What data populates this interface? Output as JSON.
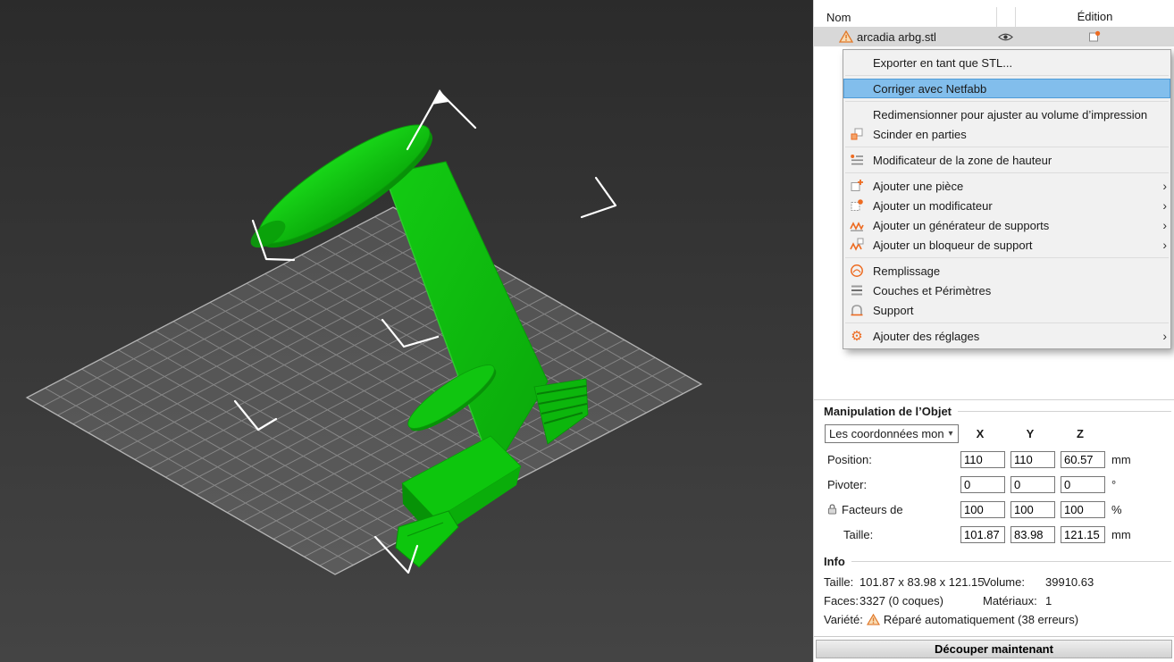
{
  "colors": {
    "accent_orange": "#ED6B21",
    "model_green": "#0CC40C",
    "menu_highlight": "#82BEEC",
    "selected_row": "#D8D8D8"
  },
  "object_list": {
    "columns": {
      "nom": "Nom",
      "edition": "Édition"
    },
    "row": {
      "filename": "arcadia arbg.stl"
    }
  },
  "context_menu": {
    "items": [
      {
        "label": "Exporter en tant que STL..."
      },
      {
        "label": "Corriger avec Netfabb"
      },
      {
        "label": "Redimensionner pour ajuster au volume d’impression"
      },
      {
        "label": "Scinder en parties"
      },
      {
        "label": "Modificateur de la zone de hauteur"
      },
      {
        "label": "Ajouter une pièce"
      },
      {
        "label": "Ajouter un modificateur"
      },
      {
        "label": "Ajouter un générateur de supports"
      },
      {
        "label": "Ajouter un bloqueur de support"
      },
      {
        "label": "Remplissage"
      },
      {
        "label": "Couches et Périmètres"
      },
      {
        "label": "Support"
      },
      {
        "label": "Ajouter des réglages"
      }
    ]
  },
  "manipulation": {
    "title": "Manipulation de l’Objet",
    "coord_select": "Les coordonnées mondi",
    "axes": {
      "x": "X",
      "y": "Y",
      "z": "Z"
    },
    "position": {
      "label": "Position:",
      "x": "110",
      "y": "110",
      "z": "60.57",
      "unit": "mm"
    },
    "rotate": {
      "label": "Pivoter:",
      "x": "0",
      "y": "0",
      "z": "0",
      "unit": "°"
    },
    "scale": {
      "label": "Facteurs de",
      "x": "100",
      "y": "100",
      "z": "100",
      "unit": "%"
    },
    "size": {
      "label": "Taille:",
      "x": "101.87",
      "y": "83.98",
      "z": "121.15",
      "unit": "mm"
    }
  },
  "info": {
    "title": "Info",
    "size_label": "Taille:",
    "size_value": "101.87 x 83.98 x 121.15",
    "volume_label": "Volume:",
    "volume_value": "39910.63",
    "faces_label": "Faces:",
    "faces_value": "3327 (0 coques)",
    "materials_label": "Matériaux:",
    "materials_value": "1",
    "variety_label": "Variété:",
    "variety_value": "Réparé automatiquement (38 erreurs)"
  },
  "slice_button": "Découper maintenant"
}
